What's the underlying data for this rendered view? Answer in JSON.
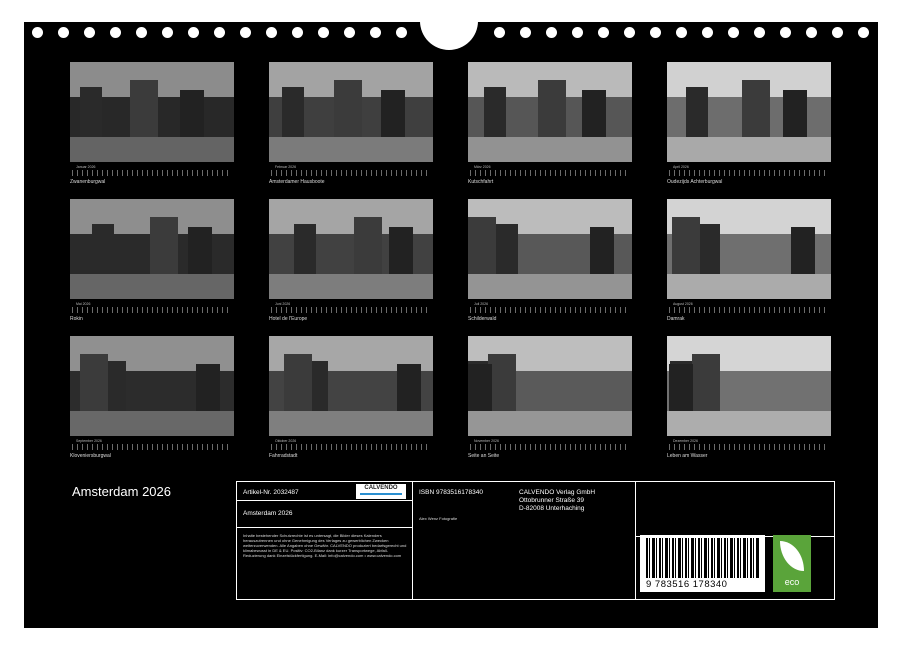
{
  "calendar_title": "Amsterdam 2026",
  "months": [
    {
      "month": "Januar 2026",
      "caption": "Zwanenburgwal"
    },
    {
      "month": "Februar 2026",
      "caption": "Amsterdamer Hausboote"
    },
    {
      "month": "März 2026",
      "caption": "Kutschfahrt"
    },
    {
      "month": "April 2026",
      "caption": "Oudezijds Achterburgwal"
    },
    {
      "month": "Mai 2026",
      "caption": "Rokin"
    },
    {
      "month": "Juni 2026",
      "caption": "Hotel de l'Europe"
    },
    {
      "month": "Juli 2026",
      "caption": "Schilderwald"
    },
    {
      "month": "August 2026",
      "caption": "Damrak"
    },
    {
      "month": "September 2026",
      "caption": "Kloveniersburgwal"
    },
    {
      "month": "Oktober 2026",
      "caption": "Fahrradstadt"
    },
    {
      "month": "November 2026",
      "caption": "Seite an Seite"
    },
    {
      "month": "Dezember 2026",
      "caption": "Leben am Wasser"
    }
  ],
  "info": {
    "article": "Artikel-Nr. 2032487",
    "product_title": "Amsterdam 2026",
    "logo_text": "CALVENDO",
    "isbn": "ISBN 9783516178340",
    "publisher_name": "CALVENDO Verlag GmbH",
    "publisher_street": "Ottobrunner Straße 39",
    "publisher_city": "D-82008 Unterhaching",
    "photographer": "Alex Wenz Fotografie",
    "legal": "Inhalte bestehender Schutzrechte ist es untersagt, die Bilder dieses Kalenders herauszutrennen und ohne Genehmigung des Verlages zu gewerblichen Zwecken weiterzuverwenden. Alle Angaben ohne Gewähr. CALVENDO produziert bedarfsgerecht und klimabewusst in DE & EU. Positiv: CO2-Bilanz dank kurzer Transportwege, Abfall-Reduzierung dank Einzelstückfertigung. E-Mail: info@calvendo.com • www.calvendo.com",
    "barcode_number": "9 783516 178340",
    "eco_label": "eco"
  }
}
